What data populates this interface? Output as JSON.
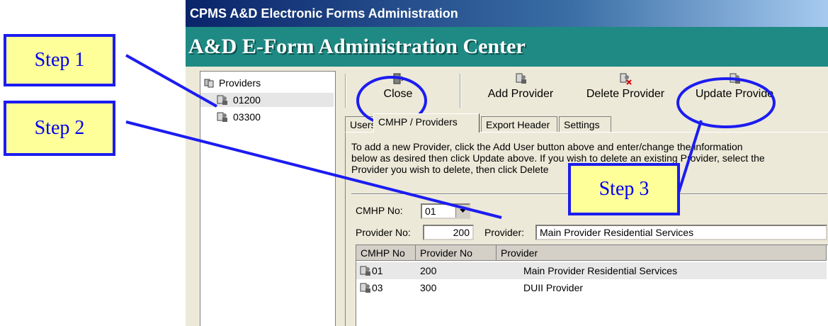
{
  "window": {
    "title": "CPMS A&D Electronic Forms Administration",
    "banner": "A&D E-Form Administration Center"
  },
  "tree": {
    "root_label": "Providers",
    "items": [
      "01200",
      "03300"
    ]
  },
  "toolbar": {
    "close_label": "Close",
    "add_label": "Add Provider",
    "delete_label": "Delete Provider",
    "update_label": "Update Provide"
  },
  "tabs": [
    "Users",
    "CMHP / Providers",
    "Export Header",
    "Settings"
  ],
  "panel": {
    "description_lines": [
      "To add a new Provider, click the Add User button above and enter/change the information",
      "below as desired then click Update above.  If you wish to delete an existing Provider, select the",
      "Provider you wish to delete, then click Delete"
    ],
    "cmhp_label": "CMHP No:",
    "cmhp_value": "01",
    "provider_no_label": "Provider No:",
    "provider_no_value": "200",
    "provider_label": "Provider:",
    "provider_value": "Main Provider Residential Services"
  },
  "grid": {
    "columns": [
      "CMHP No",
      "Provider No",
      "Provider"
    ],
    "rows": [
      {
        "cmhp": "01",
        "provider_no": "200",
        "provider": "Main Provider Residential Services"
      },
      {
        "cmhp": "03",
        "provider_no": "300",
        "provider": "DUII Provider"
      }
    ]
  },
  "callouts": {
    "step1": "Step 1",
    "step2": "Step 2",
    "step3": "Step 3"
  },
  "colors": {
    "annotation_blue": "#1c1cf0",
    "callout_fill": "#ffff99",
    "banner_teal": "#1f8a84"
  }
}
